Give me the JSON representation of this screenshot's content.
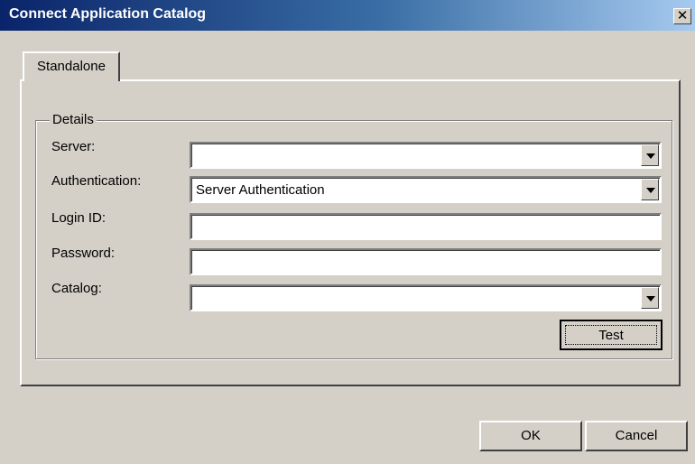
{
  "window": {
    "title": "Connect Application Catalog",
    "close_glyph": "✕"
  },
  "tabs": [
    {
      "label": "Standalone",
      "active": true
    }
  ],
  "details": {
    "group_label": "Details",
    "server": {
      "label": "Server:",
      "value": ""
    },
    "authentication": {
      "label": "Authentication:",
      "value": "Server Authentication"
    },
    "login_id": {
      "label": "Login ID:",
      "value": ""
    },
    "password": {
      "label": "Password:",
      "value": ""
    },
    "catalog": {
      "label": "Catalog:",
      "value": ""
    },
    "test_label": "Test"
  },
  "footer": {
    "ok_label": "OK",
    "cancel_label": "Cancel"
  }
}
